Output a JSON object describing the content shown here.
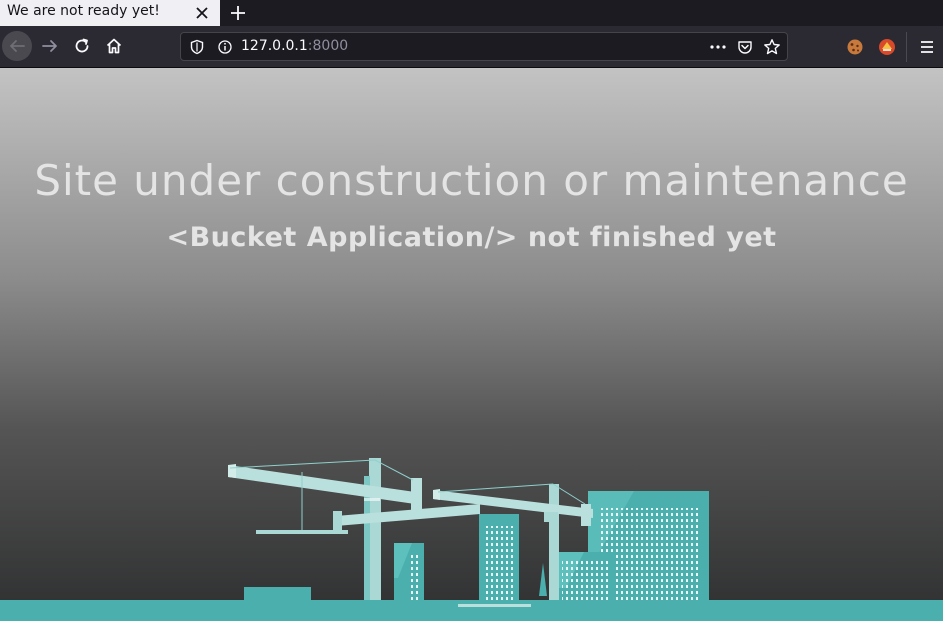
{
  "browser": {
    "tab": {
      "title": "We are not ready yet!"
    },
    "url": {
      "host": "127.0.0.1",
      "port": ":8000"
    }
  },
  "page": {
    "headline": "Site under construction or maintenance",
    "subheadline": "<Bucket Application/> not finished yet"
  },
  "colors": {
    "accent": "#4aafad",
    "crane": "#a9d8d5",
    "ground": "#4aafad"
  },
  "icons": [
    "close-icon",
    "plus-icon",
    "back-arrow-icon",
    "forward-arrow-icon",
    "reload-icon",
    "home-icon",
    "tracking-shield-icon",
    "info-icon",
    "more-dots-icon",
    "pocket-icon",
    "bookmark-star-icon",
    "cookie-extension-icon",
    "extension-icon",
    "hamburger-menu-icon"
  ]
}
